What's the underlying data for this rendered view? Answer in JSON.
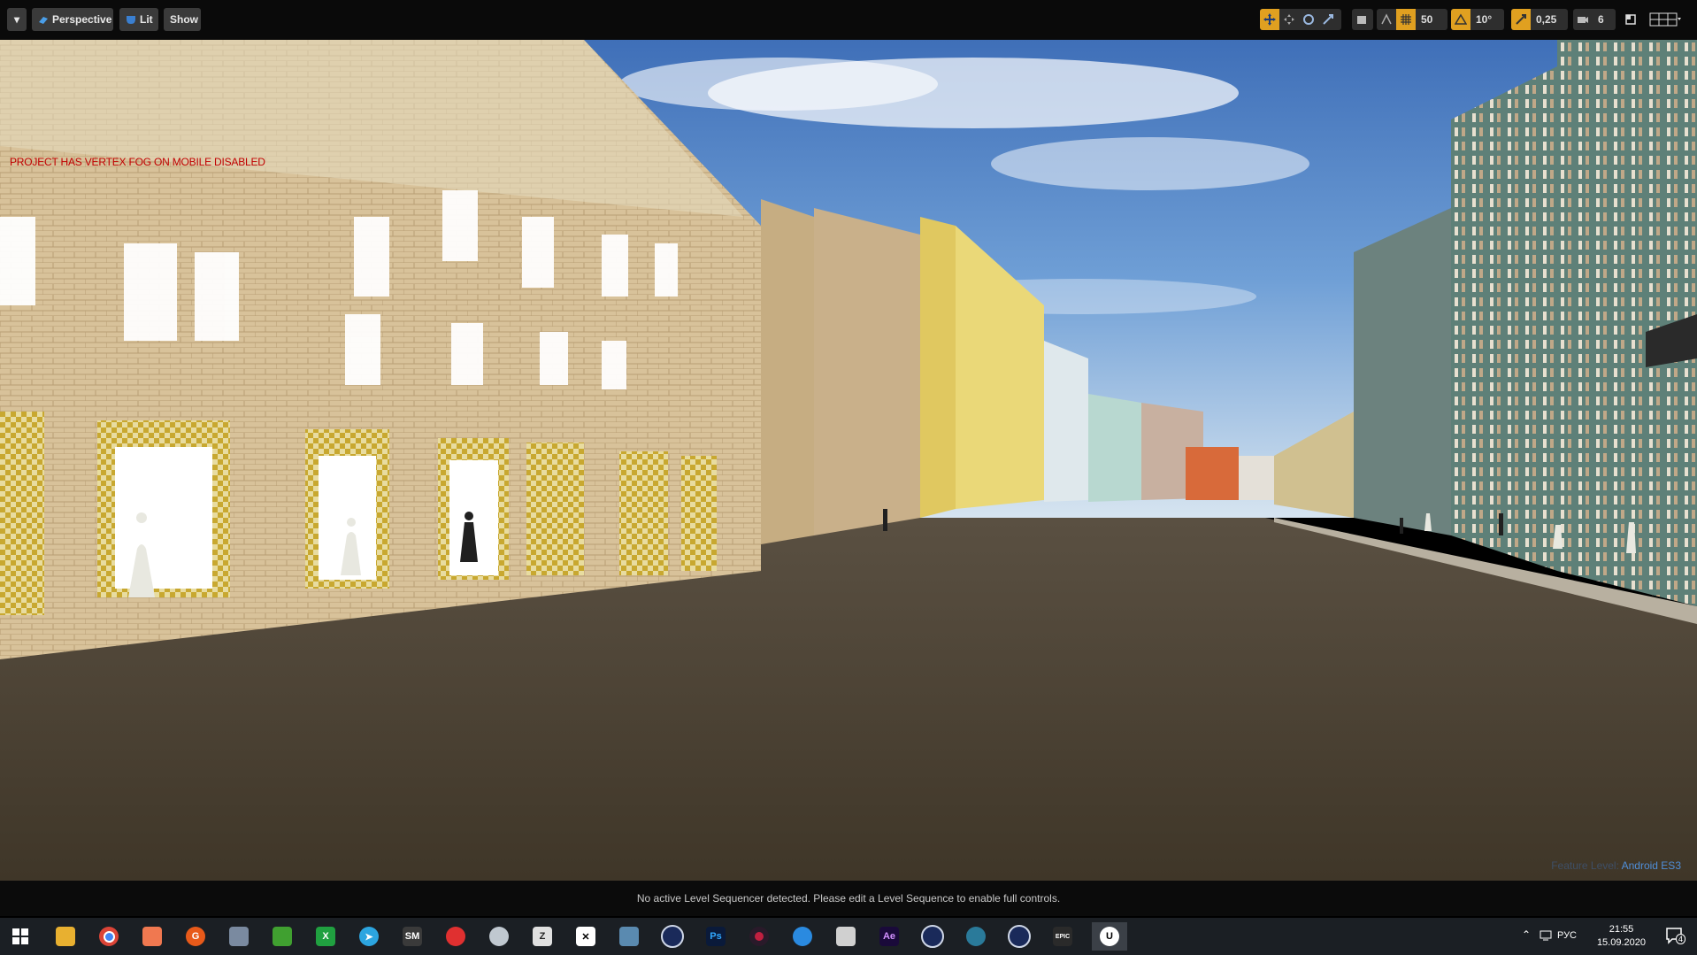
{
  "toolbar": {
    "viewport_menu_arrow": "▾",
    "perspective_label": "Perspective",
    "lit_label": "Lit",
    "show_label": "Show",
    "grid_snap_value": "50",
    "rotation_snap_value": "10°",
    "scale_snap_value": "0,25",
    "camera_speed_value": "6"
  },
  "viewport": {
    "warning_text": "PROJECT HAS VERTEX FOG ON MOBILE DISABLED",
    "feature_level_label": "Feature Level:",
    "feature_level_value": "Android ES3"
  },
  "sequencer": {
    "message": "No active Level Sequencer detected. Please edit a Level Sequence to enable full controls."
  },
  "taskbar": {
    "icons": [
      "windows-start-icon",
      "file-explorer-icon",
      "chrome-icon",
      "photo-app-icon",
      "gcode-app-icon",
      "mail-app-icon",
      "textures-app-icon",
      "xnview-icon",
      "telegram-icon",
      "sm-app-icon",
      "mapping-app-icon",
      "disk-app-icon",
      "zbrush-icon",
      "capcut-icon",
      "tools-app-icon",
      "cinema4d-icon",
      "photoshop-icon",
      "davinci-icon",
      "app-store-icon",
      "clapper-icon",
      "after-effects-icon",
      "cinema4d-2-icon",
      "mudbox-icon",
      "cinema4d-3-icon",
      "epic-games-icon",
      "unreal-engine-icon"
    ],
    "lang": "РУС",
    "time": "21:55",
    "date": "15.09.2020",
    "notification_count": "4"
  },
  "colors": {
    "toolbar_bg": "#0a0a0a",
    "button_bg": "#3a3a3a",
    "accent_orange": "#e0a020",
    "accent_blue": "#3a7fd0",
    "warning_red": "#c00000",
    "taskbar_bg": "#1b1f24"
  }
}
